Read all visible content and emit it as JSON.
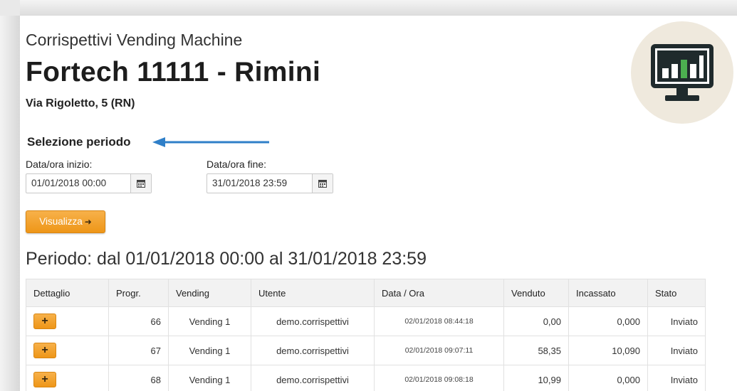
{
  "header": {
    "subtitle": "Corrispettivi Vending Machine",
    "title": "Fortech 11111 - Rimini",
    "address": "Via Rigoletto, 5 (RN)"
  },
  "period_selection": {
    "label": "Selezione periodo",
    "start_label": "Data/ora inizio:",
    "start_value": "01/01/2018 00:00",
    "end_label": "Data/ora fine:",
    "end_value": "31/01/2018 23:59",
    "button_label": "Visualizza"
  },
  "result": {
    "period_text": "Periodo: dal 01/01/2018 00:00 al 31/01/2018 23:59"
  },
  "table": {
    "columns": [
      "Dettaglio",
      "Progr.",
      "Vending",
      "Utente",
      "Data / Ora",
      "Venduto",
      "Incassato",
      "Stato"
    ],
    "rows": [
      {
        "progr": "66",
        "vending": "Vending 1",
        "utente": "demo.corrispettivi",
        "data_ora": "02/01/2018 08:44:18",
        "venduto": "0,00",
        "incassato": "0,000",
        "stato": "Inviato"
      },
      {
        "progr": "67",
        "vending": "Vending 1",
        "utente": "demo.corrispettivi",
        "data_ora": "02/01/2018 09:07:11",
        "venduto": "58,35",
        "incassato": "10,090",
        "stato": "Inviato"
      },
      {
        "progr": "68",
        "vending": "Vending 1",
        "utente": "demo.corrispettivi",
        "data_ora": "02/01/2018 09:08:18",
        "venduto": "10,99",
        "incassato": "0,000",
        "stato": "Inviato"
      }
    ]
  },
  "icons": {
    "logo": "monitor-bar-chart-icon",
    "calendar": "calendar-icon",
    "detail": "plus-icon",
    "annotation": "arrow-left-icon"
  },
  "colors": {
    "accent": "#ee9618",
    "annotation_arrow": "#2f7fc8",
    "chart_bars": "#4caf50"
  }
}
